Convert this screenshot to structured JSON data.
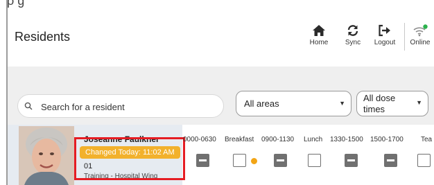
{
  "header": {
    "title": "Residents",
    "nav": [
      {
        "label": "Home",
        "icon": "home-icon"
      },
      {
        "label": "Sync",
        "icon": "sync-icon"
      },
      {
        "label": "Logout",
        "icon": "logout-icon"
      },
      {
        "label": "Online",
        "icon": "wifi-icon"
      }
    ],
    "online_status_color": "#2bb24c"
  },
  "top_crop_text": "ρ g",
  "filters": {
    "search_placeholder": "Search for a resident",
    "area": "All areas",
    "dose_times": [
      "All dose",
      "times"
    ]
  },
  "resident": {
    "name": "Joseanne Faulkner",
    "badge": "Changed Today: 11:02 AM",
    "room": "01",
    "ward": "Training - Hospital Wing",
    "badge_color": "#f2b12c",
    "highlight_color": "#e51c23"
  },
  "time_slots": [
    "0000-0630",
    "Breakfast",
    "0900-1130",
    "Lunch",
    "1330-1500",
    "1500-1700",
    "Tea"
  ],
  "slot_states": [
    "given",
    "pending",
    "given",
    "pending",
    "given",
    "given",
    "pending"
  ],
  "pending_dot_color": "#f2a516"
}
